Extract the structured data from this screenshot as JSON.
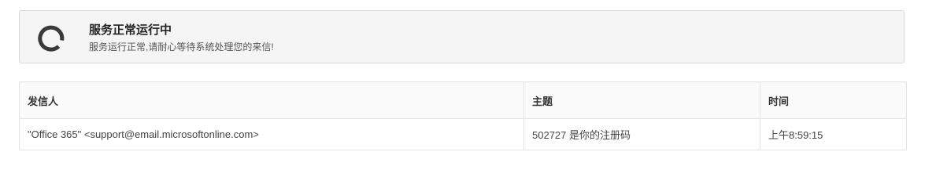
{
  "status": {
    "icon": "spinner-ring-icon",
    "title": "服务正常运行中",
    "description": "服务运行正常,请耐心等待系统处理您的来信!"
  },
  "table": {
    "headers": [
      "发信人",
      "主题",
      "时间"
    ],
    "rows": [
      {
        "sender": "\"Office 365\" <support@email.microsoftonline.com>",
        "subject": "502727 是你的注册码",
        "time": "上午8:59:15"
      }
    ]
  },
  "colors": {
    "panel_background": "#f5f5f5",
    "panel_border": "#d8d8d8",
    "icon_color": "#3a3a3a",
    "table_border": "#e3e3e3"
  }
}
